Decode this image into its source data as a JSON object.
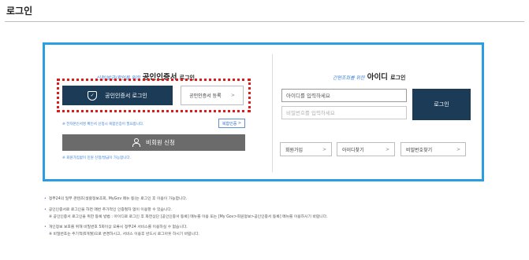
{
  "page": {
    "title": "로그인"
  },
  "cert": {
    "heading_em": "신청/발급/확인을 위한",
    "heading_big": "공인인증서",
    "heading_small": "로그인",
    "login_label": "공인인증서 로그인",
    "register_label": "공인인증서 등록",
    "note": "※ 전자본인서명 확인서 신청시 복합인증이 필요합니다.",
    "joint_label": "복합인증",
    "nonmember_label": "비회원 신청",
    "nonmember_note": "※ 회원가입없이 민원 신청/발급이 가능합니다."
  },
  "id_login": {
    "heading_em": "간편조회를 위한",
    "heading_big": "아이디",
    "heading_small": "로그인",
    "id_placeholder": "아이디를 입력하세요",
    "pw_placeholder": "비밀번호를 입력하세요",
    "login_label": "로그인",
    "signup_label": "회원가입",
    "find_id_label": "아이디찾기",
    "find_pw_label": "비밀번호찾기"
  },
  "info": [
    "정부24의 일부 콘텐츠(생활정보조회, MyGov 메뉴 등)는 로그인 후 이용이 가능합니다.",
    "공인인증서로 로그인을 하면 매번 추가적인 인증절차 없이 이용할 수 있습니다.",
    "※ 공인인증서 로그인을 위한 등록 방법 : 아이디로 로그인 후 화면상단 [공인인증서 등록] 메뉴를 이용 또는 [My Gov>회원정보>공인인증서 등록] 메뉴를 이용하시기 바랍니다.",
    "개인정보 보호를 위해 비밀번호 5회이상 오류시 정부24 서비스를 이용하실 수 없습니다.",
    "※ 비밀번호는 주기적(6개월)으로 변경하시고, 서비스 이용후 반드시 로그아웃 하시기 바랍니다."
  ],
  "icons": {
    "cert_login": "shield-check-icon",
    "nonmember": "person-icon",
    "chevron": "chevron-right-icon"
  },
  "colors": {
    "accent_border": "#2a9ee0",
    "primary_button": "#1b3b57",
    "highlight_frame": "#e01919",
    "note_text": "#3a7fd5",
    "nonmember_button": "#6b6b6b"
  }
}
